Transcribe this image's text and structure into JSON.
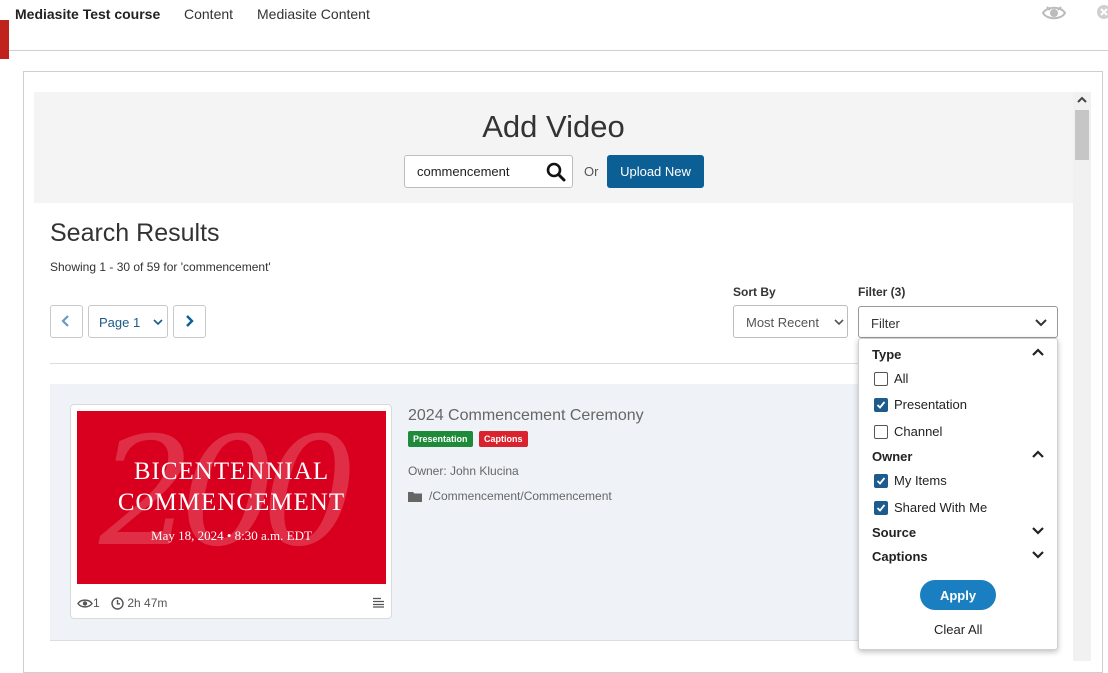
{
  "header": {
    "course_title": "Mediasite Test course",
    "nav": [
      "Content",
      "Mediasite Content"
    ]
  },
  "dialog": {
    "title": "Add Video",
    "search_value": "commencement",
    "or_text": "Or",
    "upload_label": "Upload New"
  },
  "results": {
    "title": "Search Results",
    "showing_text": "Showing 1 - 30 of 59 for 'commencement'",
    "page_label": "Page 1",
    "sort_by_label": "Sort By",
    "sort_value": "Most Recent",
    "filter_label": "Filter (3)",
    "filter_value": "Filter"
  },
  "item": {
    "title": "2024 Commencement Ceremony",
    "badges": [
      {
        "label": "Presentation",
        "color": "#1e8a3a"
      },
      {
        "label": "Captions",
        "color": "#d9232e"
      }
    ],
    "owner": "Owner: John Klucina",
    "folder": "/Commencement/Commencement",
    "views": "1",
    "duration": "2h 47m",
    "thumbnail": {
      "big_number": "200",
      "line1": "BICENTENNIAL",
      "line2": "COMMENCEMENT",
      "line3": "May 18, 2024  •  8:30 a.m. EDT",
      "bg_color": "#d8001e"
    }
  },
  "filter_panel": {
    "type_label": "Type",
    "type_options": [
      {
        "label": "All",
        "checked": false
      },
      {
        "label": "Presentation",
        "checked": true
      },
      {
        "label": "Channel",
        "checked": false
      }
    ],
    "owner_label": "Owner",
    "owner_options": [
      {
        "label": "My Items",
        "checked": true
      },
      {
        "label": "Shared With Me",
        "checked": true
      }
    ],
    "source_label": "Source",
    "captions_label": "Captions",
    "apply_label": "Apply",
    "clear_label": "Clear All"
  }
}
